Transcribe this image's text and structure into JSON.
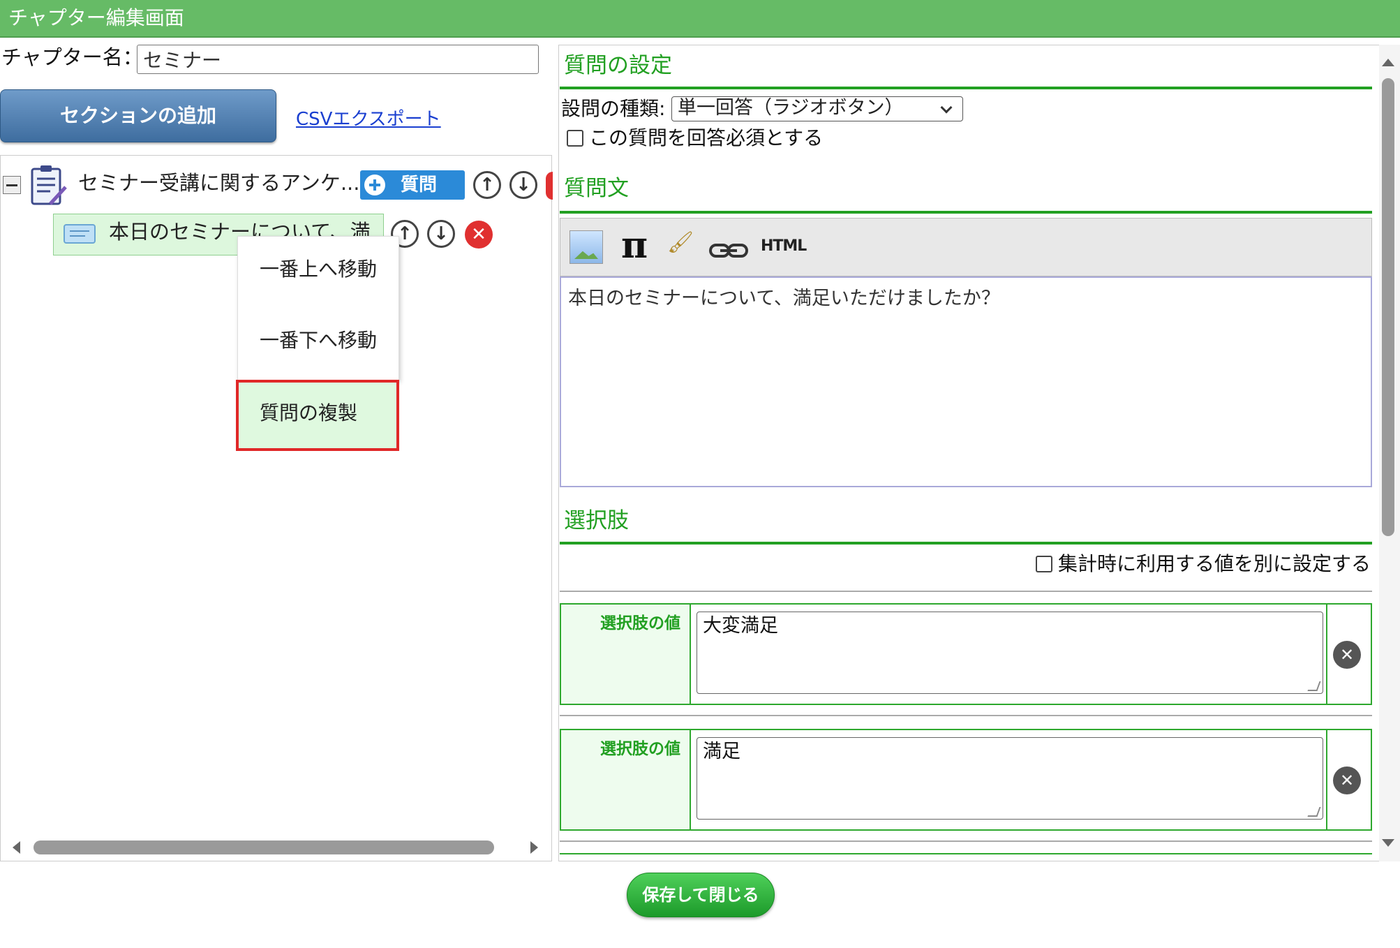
{
  "window": {
    "title": "チャプター編集画面"
  },
  "chapter": {
    "label": "チャプター名：",
    "name_value": "セミナー"
  },
  "actions": {
    "add_section": "セクションの追加",
    "csv_export": "CSVエクスポート"
  },
  "tree": {
    "section_label": "セミナー受講に関するアンケ...",
    "add_question": "質問",
    "question_label": "本日のセミナーについて、満"
  },
  "context_menu": {
    "items": [
      "一番上へ移動",
      "一番下へ移動",
      "質問の複製"
    ],
    "highlighted": "質問の複製"
  },
  "settings": {
    "heading": "質問の設定",
    "type_label": "設問の種類:",
    "type_value": "単一回答（ラジオボタン）",
    "required_label": "この質問を回答必須とする",
    "required_checked": false
  },
  "question_text": {
    "heading": "質問文",
    "toolbar": {
      "html_label": "HTML",
      "pi_symbol": "π"
    },
    "value": "本日のセミナーについて、満足いただけましたか？"
  },
  "choices": {
    "heading": "選択肢",
    "aggregate_label": "集計時に利用する値を別に設定する",
    "aggregate_checked": false,
    "value_label": "選択肢の値",
    "items": [
      {
        "value": "大変満足"
      },
      {
        "value": "満足"
      }
    ]
  },
  "footer": {
    "save_close": "保存して閉じる"
  },
  "colors": {
    "title_bar": "#66bb66",
    "accent_green": "#22a022",
    "highlight_border": "#e02828",
    "button_blue": "#3e6d9f"
  }
}
